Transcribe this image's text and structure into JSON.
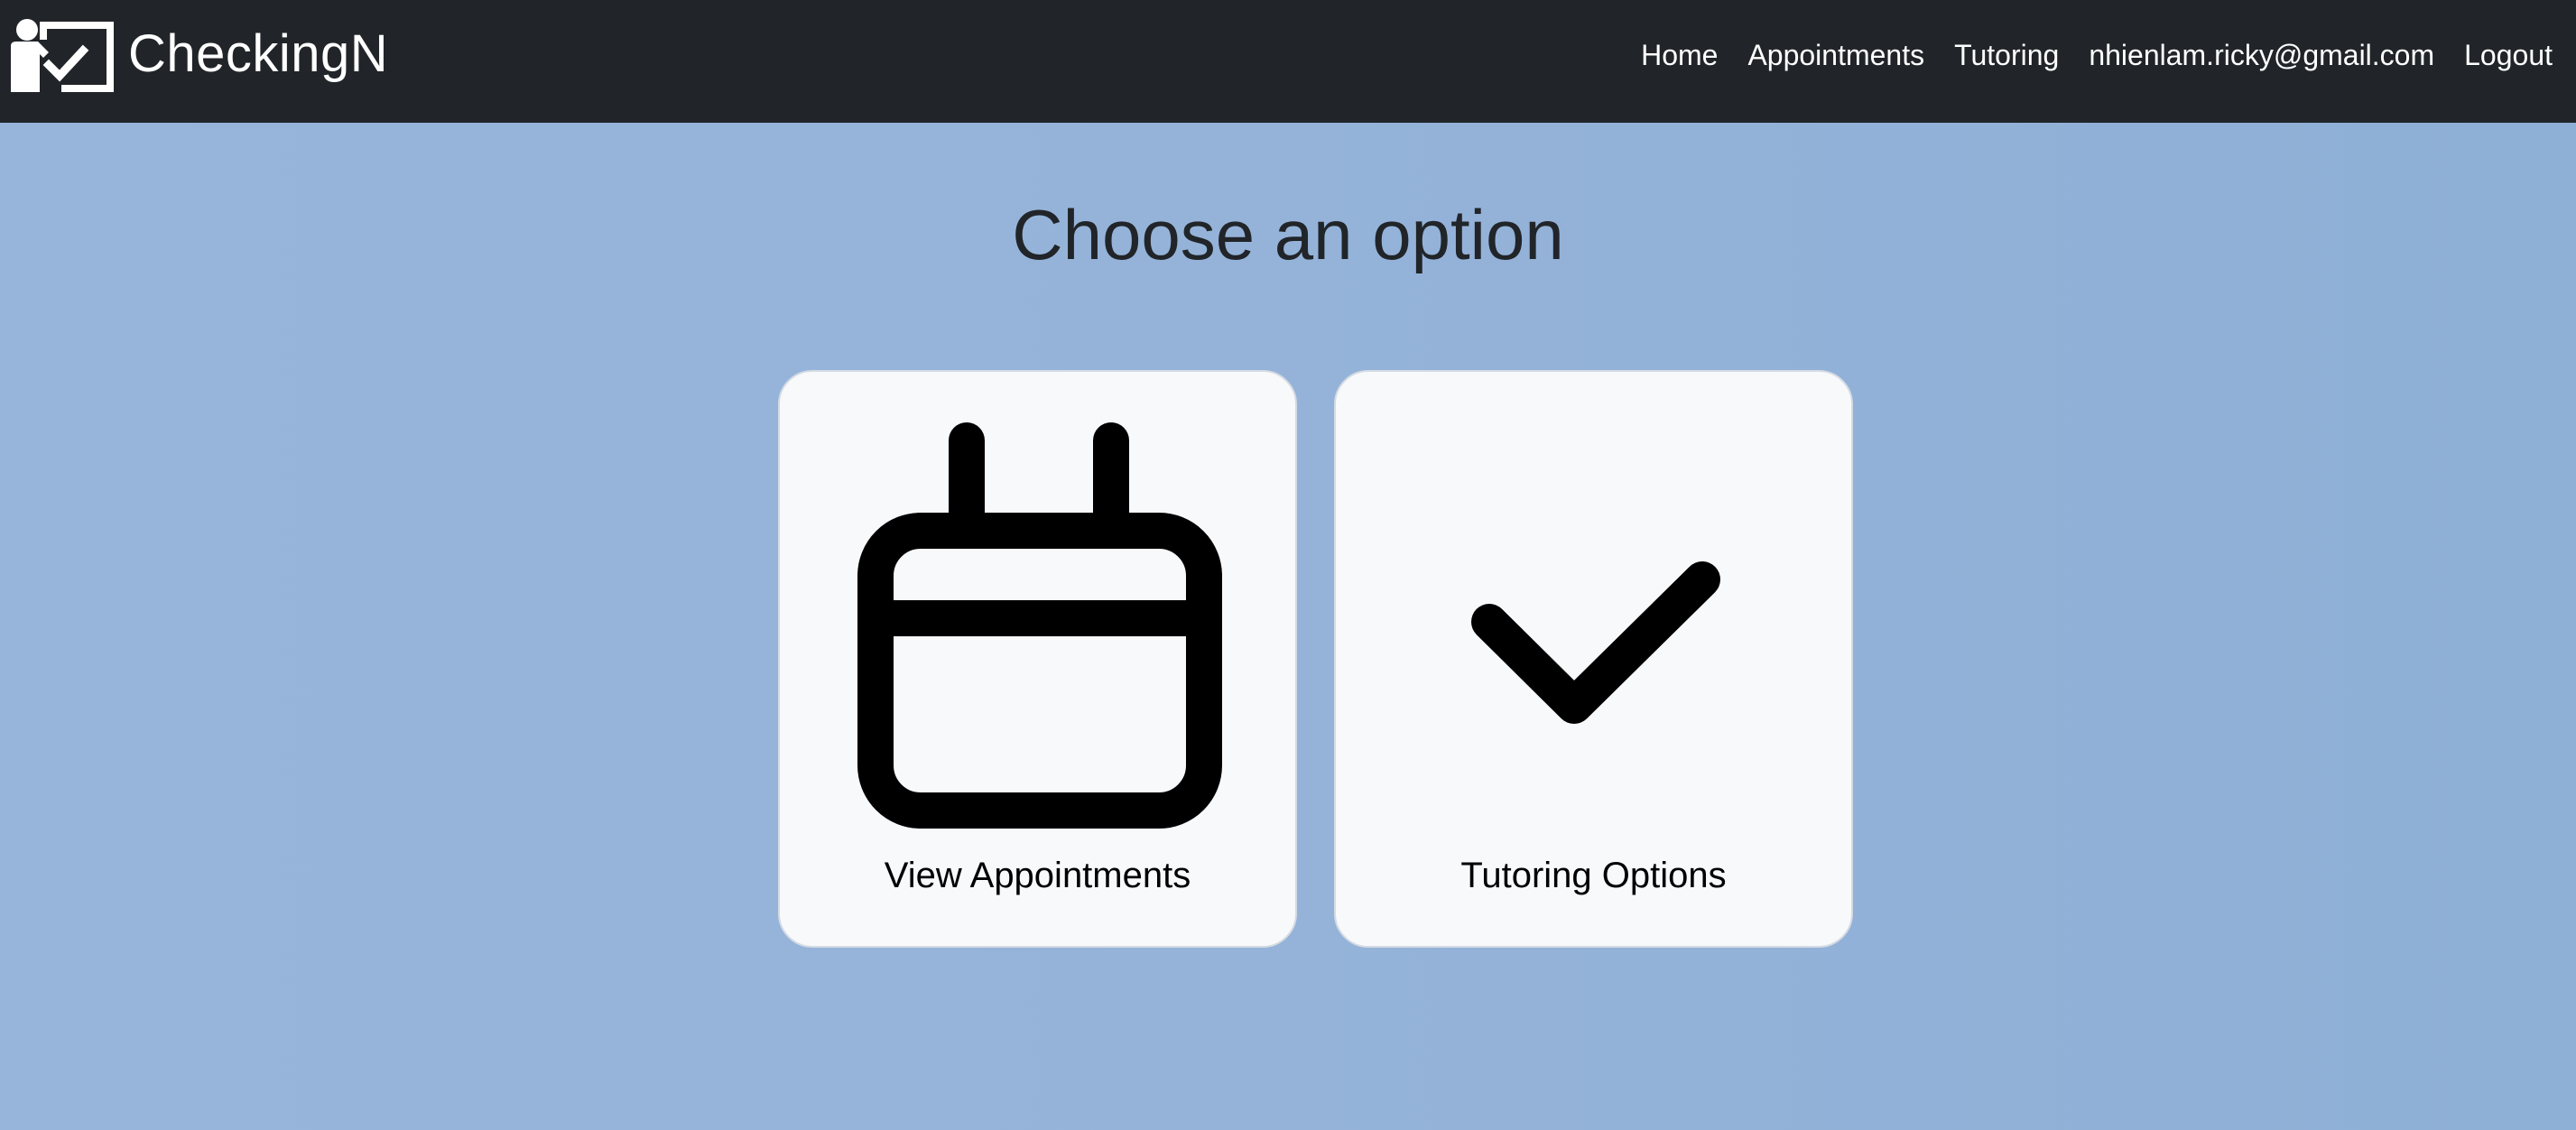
{
  "navbar": {
    "brand_name": "CheckingN",
    "links": [
      "Home",
      "Appointments",
      "Tutoring",
      "nhienlam.ricky@gmail.com",
      "Logout"
    ]
  },
  "main": {
    "heading": "Choose an option",
    "cards": [
      {
        "label": "View Appointments",
        "icon": "calendar-icon"
      },
      {
        "label": "Tutoring Options",
        "icon": "checkmark-icon"
      }
    ]
  },
  "colors": {
    "navbar_bg": "#212529",
    "page_bg": "#95b3d9",
    "card_bg": "#f8f9fb",
    "heading_text": "#212529"
  }
}
